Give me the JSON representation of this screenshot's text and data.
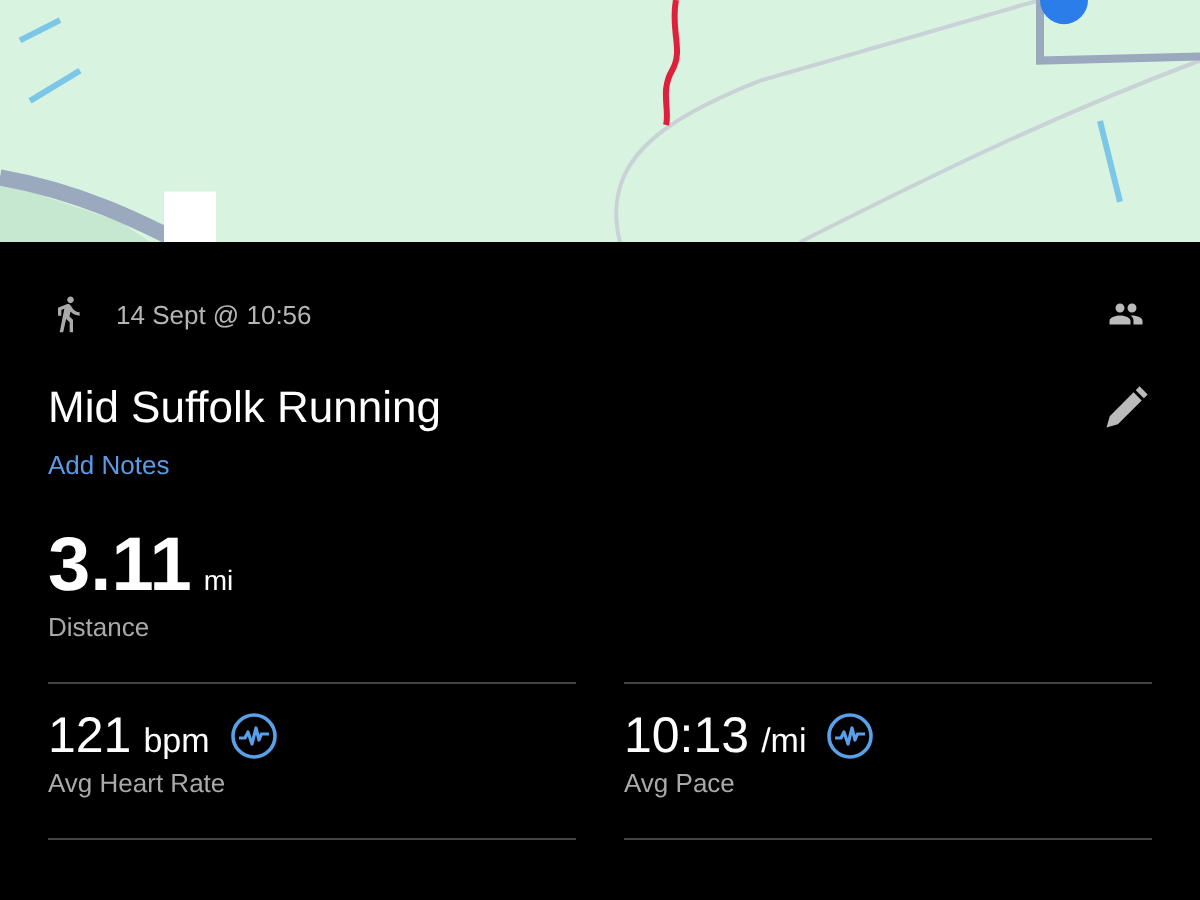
{
  "activity": {
    "date": "14 Sept @ 10:56",
    "title": "Mid Suffolk Running",
    "notes_link": "Add Notes"
  },
  "primary_stat": {
    "value": "3.11",
    "unit": "mi",
    "label": "Distance"
  },
  "stats": [
    {
      "value": "121",
      "unit": "bpm",
      "label": "Avg Heart Rate",
      "chart_icon": true
    },
    {
      "value": "10:13",
      "unit": "/mi",
      "label": "Avg Pace",
      "chart_icon": true
    }
  ]
}
